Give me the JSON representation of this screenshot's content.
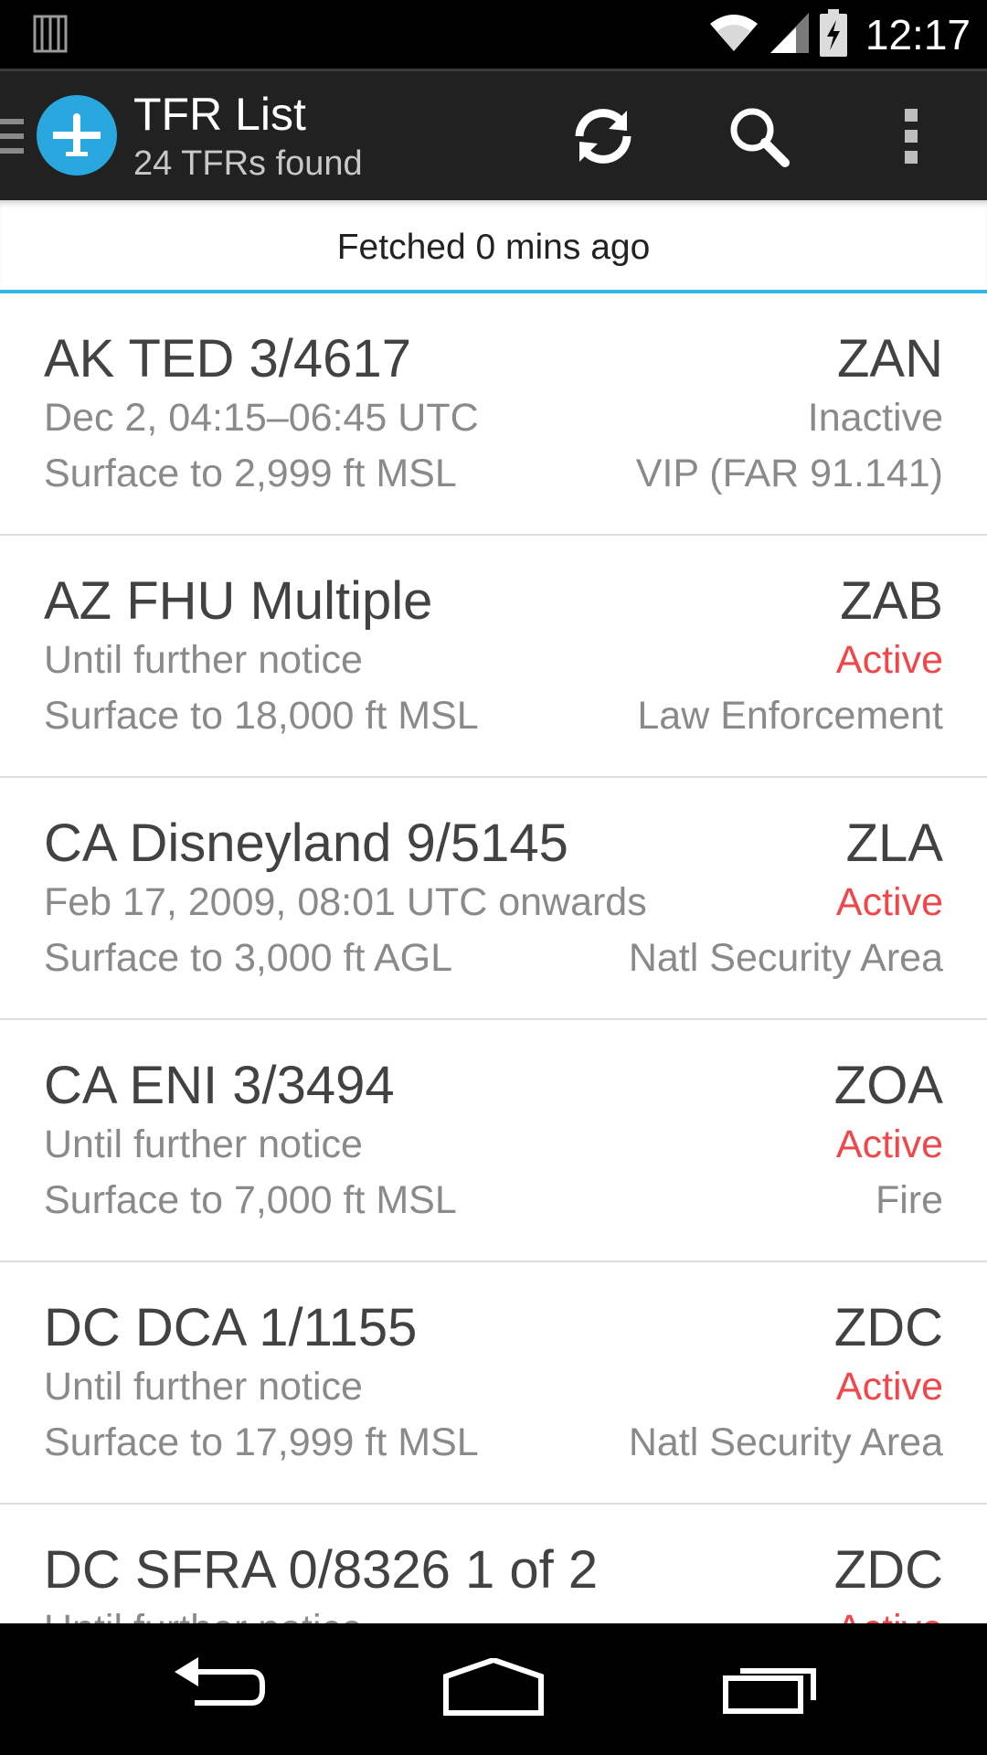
{
  "status_bar": {
    "time": "12:17",
    "icons": [
      "notification-icon",
      "wifi-icon",
      "signal-icon",
      "battery-charging-icon"
    ]
  },
  "action_bar": {
    "title": "TFR List",
    "subtitle": "24 TFRs found",
    "actions": [
      "refresh-icon",
      "search-icon",
      "overflow-menu-icon"
    ]
  },
  "fetched": {
    "text": "Fetched 0 mins ago"
  },
  "colors": {
    "action_bar_bg": "#212121",
    "accent": "#33b5e5",
    "logo_bg": "#29a8e0",
    "active": "#f0474b",
    "secondary_text": "#8a8a8a"
  },
  "tfrs": [
    {
      "name": "AK TED 3/4617",
      "center": "ZAN",
      "time": "Dec 2, 04:15–06:45 UTC",
      "status": "Inactive",
      "altitude": "Surface to 2,999 ft MSL",
      "type": "VIP (FAR 91.141)"
    },
    {
      "name": "AZ FHU Multiple",
      "center": "ZAB",
      "time": "Until further notice",
      "status": "Active",
      "altitude": "Surface to 18,000 ft MSL",
      "type": "Law Enforcement"
    },
    {
      "name": "CA Disneyland 9/5145",
      "center": "ZLA",
      "time": "Feb 17, 2009, 08:01 UTC onwards",
      "status": "Active",
      "altitude": "Surface to 3,000 ft AGL",
      "type": "Natl Security Area"
    },
    {
      "name": "CA ENI 3/3494",
      "center": "ZOA",
      "time": "Until further notice",
      "status": "Active",
      "altitude": "Surface to 7,000 ft MSL",
      "type": "Fire"
    },
    {
      "name": "DC DCA 1/1155",
      "center": "ZDC",
      "time": "Until further notice",
      "status": "Active",
      "altitude": "Surface to 17,999 ft MSL",
      "type": "Natl Security Area"
    },
    {
      "name": "DC SFRA 0/8326 1 of 2",
      "center": "ZDC",
      "time": "Until further notice",
      "status": "Active",
      "altitude": "",
      "type": ""
    }
  ],
  "nav_bar": [
    "back-icon",
    "home-icon",
    "recent-apps-icon"
  ]
}
